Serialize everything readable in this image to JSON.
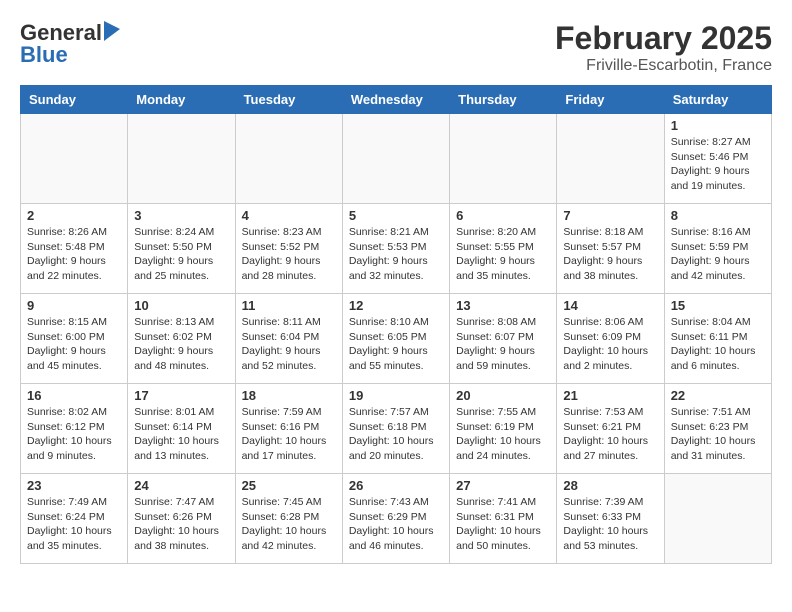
{
  "header": {
    "logo_general": "General",
    "logo_blue": "Blue",
    "month_year": "February 2025",
    "location": "Friville-Escarbotin, France"
  },
  "days_of_week": [
    "Sunday",
    "Monday",
    "Tuesday",
    "Wednesday",
    "Thursday",
    "Friday",
    "Saturday"
  ],
  "weeks": [
    [
      {
        "day": "",
        "info": ""
      },
      {
        "day": "",
        "info": ""
      },
      {
        "day": "",
        "info": ""
      },
      {
        "day": "",
        "info": ""
      },
      {
        "day": "",
        "info": ""
      },
      {
        "day": "",
        "info": ""
      },
      {
        "day": "1",
        "info": "Sunrise: 8:27 AM\nSunset: 5:46 PM\nDaylight: 9 hours and 19 minutes."
      }
    ],
    [
      {
        "day": "2",
        "info": "Sunrise: 8:26 AM\nSunset: 5:48 PM\nDaylight: 9 hours and 22 minutes."
      },
      {
        "day": "3",
        "info": "Sunrise: 8:24 AM\nSunset: 5:50 PM\nDaylight: 9 hours and 25 minutes."
      },
      {
        "day": "4",
        "info": "Sunrise: 8:23 AM\nSunset: 5:52 PM\nDaylight: 9 hours and 28 minutes."
      },
      {
        "day": "5",
        "info": "Sunrise: 8:21 AM\nSunset: 5:53 PM\nDaylight: 9 hours and 32 minutes."
      },
      {
        "day": "6",
        "info": "Sunrise: 8:20 AM\nSunset: 5:55 PM\nDaylight: 9 hours and 35 minutes."
      },
      {
        "day": "7",
        "info": "Sunrise: 8:18 AM\nSunset: 5:57 PM\nDaylight: 9 hours and 38 minutes."
      },
      {
        "day": "8",
        "info": "Sunrise: 8:16 AM\nSunset: 5:59 PM\nDaylight: 9 hours and 42 minutes."
      }
    ],
    [
      {
        "day": "9",
        "info": "Sunrise: 8:15 AM\nSunset: 6:00 PM\nDaylight: 9 hours and 45 minutes."
      },
      {
        "day": "10",
        "info": "Sunrise: 8:13 AM\nSunset: 6:02 PM\nDaylight: 9 hours and 48 minutes."
      },
      {
        "day": "11",
        "info": "Sunrise: 8:11 AM\nSunset: 6:04 PM\nDaylight: 9 hours and 52 minutes."
      },
      {
        "day": "12",
        "info": "Sunrise: 8:10 AM\nSunset: 6:05 PM\nDaylight: 9 hours and 55 minutes."
      },
      {
        "day": "13",
        "info": "Sunrise: 8:08 AM\nSunset: 6:07 PM\nDaylight: 9 hours and 59 minutes."
      },
      {
        "day": "14",
        "info": "Sunrise: 8:06 AM\nSunset: 6:09 PM\nDaylight: 10 hours and 2 minutes."
      },
      {
        "day": "15",
        "info": "Sunrise: 8:04 AM\nSunset: 6:11 PM\nDaylight: 10 hours and 6 minutes."
      }
    ],
    [
      {
        "day": "16",
        "info": "Sunrise: 8:02 AM\nSunset: 6:12 PM\nDaylight: 10 hours and 9 minutes."
      },
      {
        "day": "17",
        "info": "Sunrise: 8:01 AM\nSunset: 6:14 PM\nDaylight: 10 hours and 13 minutes."
      },
      {
        "day": "18",
        "info": "Sunrise: 7:59 AM\nSunset: 6:16 PM\nDaylight: 10 hours and 17 minutes."
      },
      {
        "day": "19",
        "info": "Sunrise: 7:57 AM\nSunset: 6:18 PM\nDaylight: 10 hours and 20 minutes."
      },
      {
        "day": "20",
        "info": "Sunrise: 7:55 AM\nSunset: 6:19 PM\nDaylight: 10 hours and 24 minutes."
      },
      {
        "day": "21",
        "info": "Sunrise: 7:53 AM\nSunset: 6:21 PM\nDaylight: 10 hours and 27 minutes."
      },
      {
        "day": "22",
        "info": "Sunrise: 7:51 AM\nSunset: 6:23 PM\nDaylight: 10 hours and 31 minutes."
      }
    ],
    [
      {
        "day": "23",
        "info": "Sunrise: 7:49 AM\nSunset: 6:24 PM\nDaylight: 10 hours and 35 minutes."
      },
      {
        "day": "24",
        "info": "Sunrise: 7:47 AM\nSunset: 6:26 PM\nDaylight: 10 hours and 38 minutes."
      },
      {
        "day": "25",
        "info": "Sunrise: 7:45 AM\nSunset: 6:28 PM\nDaylight: 10 hours and 42 minutes."
      },
      {
        "day": "26",
        "info": "Sunrise: 7:43 AM\nSunset: 6:29 PM\nDaylight: 10 hours and 46 minutes."
      },
      {
        "day": "27",
        "info": "Sunrise: 7:41 AM\nSunset: 6:31 PM\nDaylight: 10 hours and 50 minutes."
      },
      {
        "day": "28",
        "info": "Sunrise: 7:39 AM\nSunset: 6:33 PM\nDaylight: 10 hours and 53 minutes."
      },
      {
        "day": "",
        "info": ""
      }
    ]
  ]
}
